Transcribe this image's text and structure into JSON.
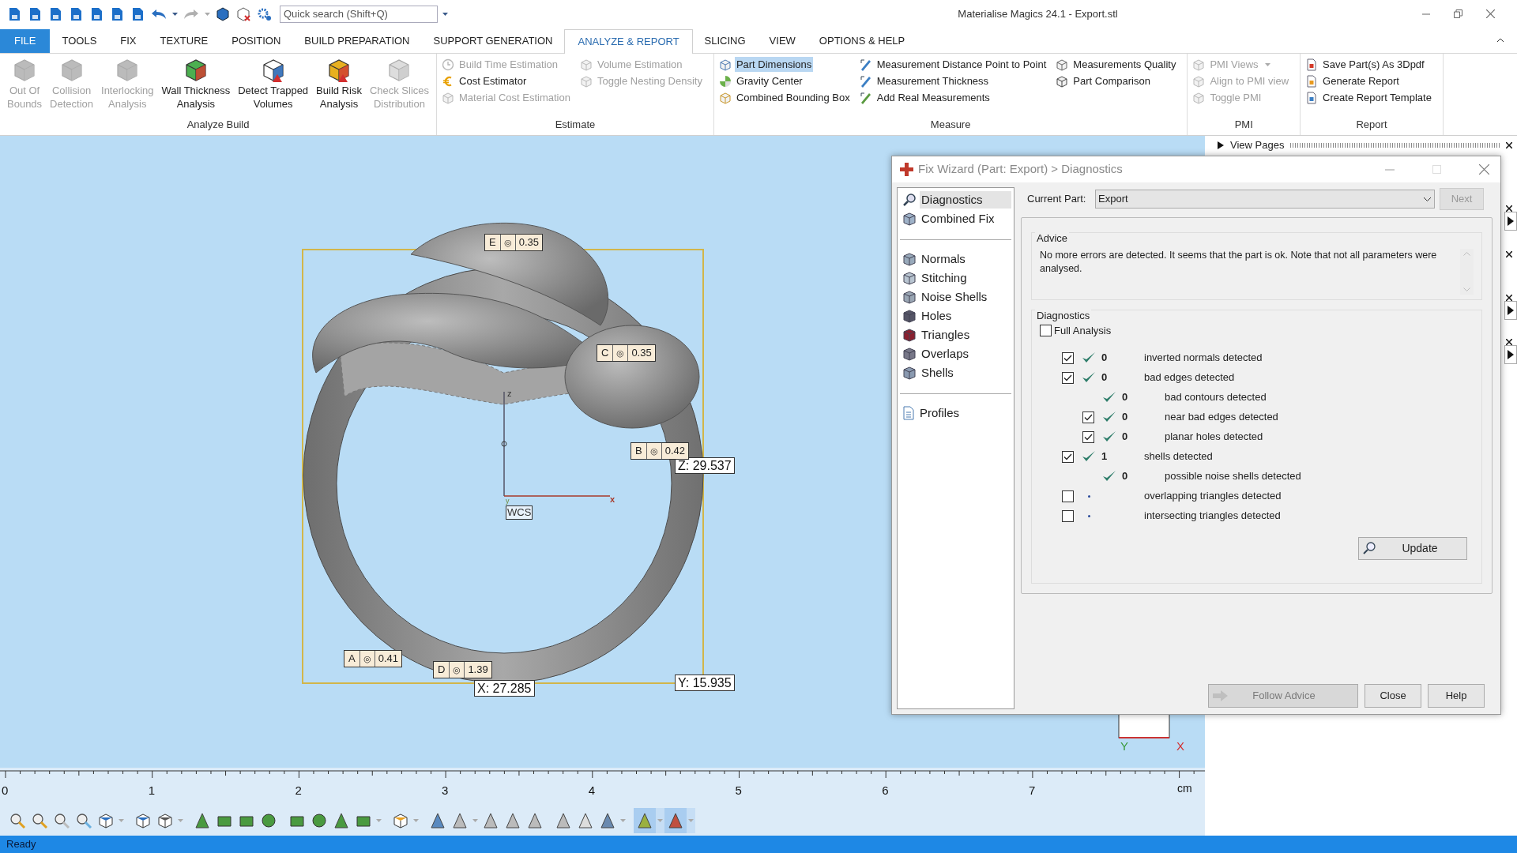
{
  "window": {
    "title": "Materialise Magics 24.1 - Export.stl"
  },
  "quick_search": {
    "placeholder": "Quick search (Shift+Q)"
  },
  "tabs": [
    {
      "label": "FILE",
      "kind": "file",
      "selected": false
    },
    {
      "label": "TOOLS",
      "kind": "tab",
      "selected": false
    },
    {
      "label": "FIX",
      "kind": "tab",
      "selected": false
    },
    {
      "label": "TEXTURE",
      "kind": "tab",
      "selected": false
    },
    {
      "label": "POSITION",
      "kind": "tab",
      "selected": false
    },
    {
      "label": "BUILD PREPARATION",
      "kind": "tab",
      "selected": false
    },
    {
      "label": "SUPPORT GENERATION",
      "kind": "tab",
      "selected": false
    },
    {
      "label": "ANALYZE & REPORT",
      "kind": "tab",
      "selected": true
    },
    {
      "label": "SLICING",
      "kind": "tab",
      "selected": false
    },
    {
      "label": "VIEW",
      "kind": "tab",
      "selected": false
    },
    {
      "label": "OPTIONS & HELP",
      "kind": "tab",
      "selected": false
    }
  ],
  "ribbon_groups": [
    {
      "title": "Analyze Build",
      "kind": "large",
      "items": [
        {
          "label": "Out Of\nBounds",
          "disabled": true
        },
        {
          "label": "Collision\nDetection",
          "disabled": true
        },
        {
          "label": "Interlocking\nAnalysis",
          "disabled": true
        },
        {
          "label": "Wall Thickness\nAnalysis",
          "disabled": false
        },
        {
          "label": "Detect Trapped\nVolumes",
          "disabled": false
        },
        {
          "label": "Build Risk\nAnalysis",
          "disabled": false
        },
        {
          "label": "Check Slices\nDistribution",
          "disabled": true
        }
      ]
    },
    {
      "title": "Estimate",
      "kind": "small",
      "columns": [
        [
          {
            "label": "Build Time Estimation",
            "disabled": true,
            "selected": false
          },
          {
            "label": "Cost Estimator",
            "disabled": false,
            "selected": false
          },
          {
            "label": "Material Cost Estimation",
            "disabled": true,
            "selected": false
          }
        ],
        [
          {
            "label": "Volume Estimation",
            "disabled": true,
            "selected": false
          },
          {
            "label": "Toggle Nesting Density",
            "disabled": true,
            "selected": false
          }
        ]
      ]
    },
    {
      "title": "Measure",
      "kind": "small",
      "columns": [
        [
          {
            "label": "Part Dimensions",
            "disabled": false,
            "selected": true
          },
          {
            "label": "Gravity Center",
            "disabled": false,
            "selected": false
          },
          {
            "label": "Combined Bounding Box",
            "disabled": false,
            "selected": false
          }
        ],
        [
          {
            "label": "Measurement Distance Point to Point",
            "disabled": false,
            "selected": false
          },
          {
            "label": "Measurement Thickness",
            "disabled": false,
            "selected": false
          },
          {
            "label": "Add Real Measurements",
            "disabled": false,
            "selected": false
          }
        ],
        [
          {
            "label": "Measurements Quality",
            "disabled": false,
            "selected": false
          },
          {
            "label": "Part Comparison",
            "disabled": false,
            "selected": false
          }
        ]
      ]
    },
    {
      "title": "PMI",
      "kind": "small",
      "columns": [
        [
          {
            "label": "PMI Views",
            "disabled": true,
            "selected": false,
            "menu": true
          },
          {
            "label": "Align to PMI view",
            "disabled": true,
            "selected": false
          },
          {
            "label": "Toggle PMI",
            "disabled": true,
            "selected": false
          }
        ]
      ]
    },
    {
      "title": "Report",
      "kind": "small",
      "columns": [
        [
          {
            "label": "Save Part(s) As 3Dpdf",
            "disabled": false,
            "selected": false
          },
          {
            "label": "Generate Report",
            "disabled": false,
            "selected": false
          },
          {
            "label": "Create Report Template",
            "disabled": false,
            "selected": false
          }
        ]
      ]
    }
  ],
  "viewport": {
    "measure_labels": [
      {
        "letter": "E",
        "symbol": "◎",
        "value": "0.35"
      },
      {
        "letter": "C",
        "symbol": "◎",
        "value": "0.35"
      },
      {
        "letter": "B",
        "symbol": "◎",
        "value": "0.42"
      },
      {
        "letter": "A",
        "symbol": "◎",
        "value": "0.41"
      },
      {
        "letter": "D",
        "symbol": "◎",
        "value": "1.39"
      }
    ],
    "coordinate_labels": [
      {
        "text": "Z: 29.537"
      },
      {
        "text": "X: 27.285"
      },
      {
        "text": "Y: 15.935"
      }
    ],
    "axes": {
      "z": "z",
      "x": "x",
      "y": "y",
      "frame": "WCS"
    },
    "orientation_axes": {
      "y": "Y",
      "x": "X"
    }
  },
  "side_panel": {
    "header": "View Pages"
  },
  "fix_wizard": {
    "title": "Fix Wizard (Part: Export) > Diagnostics",
    "nav_groups": [
      [
        {
          "label": "Diagnostics",
          "selected": true
        },
        {
          "label": "Combined Fix",
          "selected": false
        }
      ],
      [
        {
          "label": "Normals",
          "selected": false
        },
        {
          "label": "Stitching",
          "selected": false
        },
        {
          "label": "Noise Shells",
          "selected": false
        },
        {
          "label": "Holes",
          "selected": false
        },
        {
          "label": "Triangles",
          "selected": false
        },
        {
          "label": "Overlaps",
          "selected": false
        },
        {
          "label": "Shells",
          "selected": false
        }
      ],
      [
        {
          "label": "Profiles",
          "selected": false
        }
      ]
    ],
    "current_part": {
      "label": "Current Part:",
      "value": "Export"
    },
    "next_button": {
      "label": "Next",
      "disabled": true
    },
    "advice": {
      "title": "Advice",
      "text": "No more errors are detected. It seems that the part is ok. Note that not all parameters were analysed."
    },
    "diagnostics": {
      "title": "Diagnostics",
      "full_analysis": {
        "label": "Full Analysis",
        "checked": false
      },
      "rows": [
        {
          "kind": "checkable",
          "checked": true,
          "passed": true,
          "count": "0",
          "label": "inverted normals detected"
        },
        {
          "kind": "checkable",
          "checked": true,
          "passed": true,
          "count": "0",
          "label": "bad edges detected",
          "children": [
            {
              "kind": "plain",
              "passed": true,
              "count": "0",
              "label": "bad contours detected"
            },
            {
              "kind": "checkable",
              "checked": true,
              "passed": true,
              "count": "0",
              "label": "near bad edges detected"
            },
            {
              "kind": "checkable",
              "checked": true,
              "passed": true,
              "count": "0",
              "label": "planar holes detected"
            }
          ]
        },
        {
          "kind": "checkable",
          "checked": true,
          "passed": true,
          "count": "1",
          "label": "shells detected",
          "children": [
            {
              "kind": "plain",
              "passed": true,
              "count": "0",
              "label": "possible noise shells detected"
            }
          ]
        },
        {
          "kind": "checkable",
          "checked": false,
          "passed": false,
          "label": "overlapping triangles detected"
        },
        {
          "kind": "checkable",
          "checked": false,
          "passed": false,
          "label": "intersecting triangles detected"
        }
      ]
    },
    "update_button": {
      "label": "Update"
    },
    "buttons": [
      {
        "label": "Follow Advice",
        "kind": "advice",
        "disabled": true
      },
      {
        "label": "Close",
        "kind": "plain",
        "disabled": false
      },
      {
        "label": "Help",
        "kind": "plain",
        "disabled": false
      }
    ]
  },
  "ruler": {
    "ticks": [
      "0",
      "1",
      "2",
      "3",
      "4",
      "5",
      "6",
      "7"
    ],
    "unit": "cm"
  },
  "view_toolbar": [
    {
      "selected": false,
      "menu": false
    },
    {
      "selected": false,
      "menu": false
    },
    {
      "selected": false,
      "menu": false
    },
    {
      "selected": false,
      "menu": false
    },
    {
      "selected": false,
      "menu": true
    },
    {
      "selected": false,
      "menu": false
    },
    {
      "selected": false,
      "menu": true
    },
    {
      "selected": false,
      "menu": false
    },
    {
      "selected": false,
      "menu": false
    },
    {
      "selected": false,
      "menu": false
    },
    {
      "selected": false,
      "menu": false
    },
    {
      "selected": false,
      "menu": false
    },
    {
      "selected": false,
      "menu": false
    },
    {
      "selected": false,
      "menu": false
    },
    {
      "selected": false,
      "menu": true
    },
    {
      "selected": false,
      "menu": true
    },
    {
      "selected": false,
      "menu": false
    },
    {
      "selected": false,
      "menu": true
    },
    {
      "selected": false,
      "menu": false
    },
    {
      "selected": false,
      "menu": false
    },
    {
      "selected": false,
      "menu": false
    },
    {
      "selected": false,
      "menu": false
    },
    {
      "selected": false,
      "menu": false
    },
    {
      "selected": false,
      "menu": true
    },
    {
      "selected": true,
      "menu": true
    },
    {
      "selected": true,
      "menu": true
    }
  ],
  "status_bar": {
    "text": "Ready"
  }
}
